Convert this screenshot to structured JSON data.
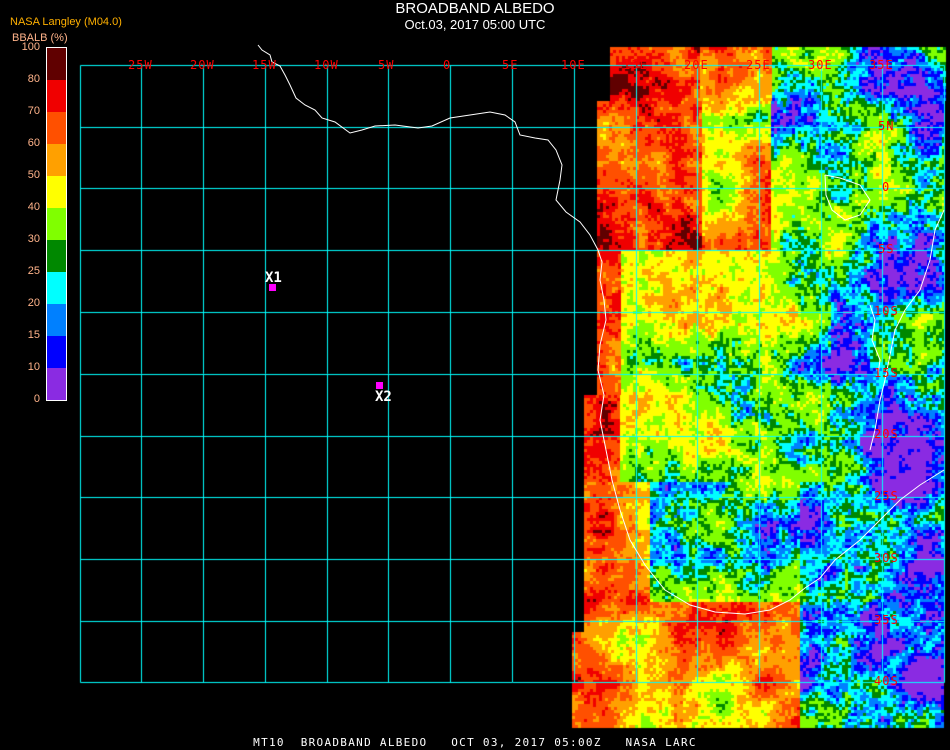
{
  "header": {
    "title": "BROADBAND ALBEDO",
    "subtitle": "Oct.03, 2017 05:00 UTC",
    "source": "NASA Langley (M04.0)"
  },
  "colorbar": {
    "title": "BBALB (%)",
    "ticks": [
      "100",
      "80",
      "70",
      "60",
      "50",
      "40",
      "30",
      "25",
      "20",
      "15",
      "10",
      "0"
    ],
    "colors": [
      "#600000",
      "#f00000",
      "#ff5000",
      "#ffa000",
      "#ffff00",
      "#80ff00",
      "#008800",
      "#00ffff",
      "#0080ff",
      "#0000ff",
      "#8a2be2"
    ]
  },
  "grid": {
    "color": "#00ffff",
    "label_color": "#ff0000",
    "lon_labels": [
      "25W",
      "20W",
      "15W",
      "10W",
      "5W",
      "0",
      "5E",
      "10E",
      "15E",
      "20E",
      "25E",
      "30E",
      "35E"
    ],
    "lat_labels": [
      "5N",
      "0",
      "5S",
      "10S",
      "15S",
      "20S",
      "25S",
      "30S",
      "35S",
      "40S"
    ]
  },
  "markers": [
    {
      "label": "X1",
      "color": "#ff00ff"
    },
    {
      "label": "X2",
      "color": "#ff00ff"
    }
  ],
  "footer": "MT10  BROADBAND ALBEDO   OCT 03, 2017 05:00Z   NASA LARC"
}
